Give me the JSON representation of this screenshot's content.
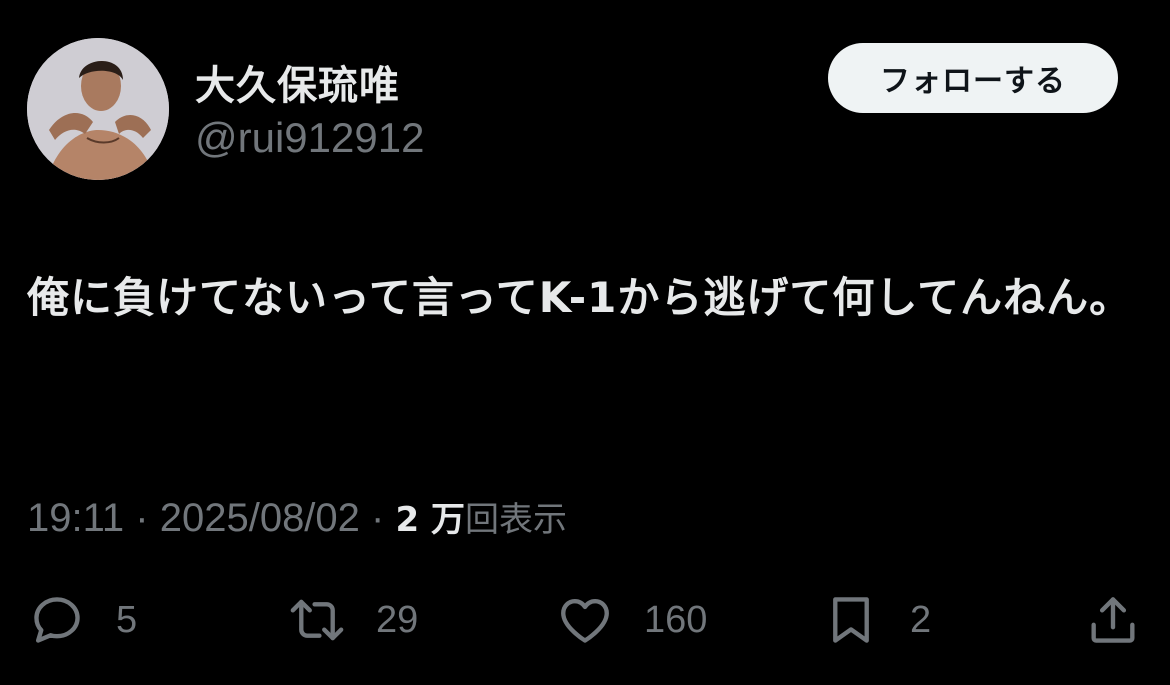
{
  "user": {
    "display_name": "大久保琉唯",
    "handle": "@rui912912",
    "avatar_icon": "avatar-photo"
  },
  "follow_button": {
    "label": "フォローする"
  },
  "tweet": {
    "text": "俺に負けてないって言ってK-1から逃げて何してんねん。"
  },
  "meta": {
    "time": "19:11",
    "separator": "·",
    "date": "2025/08/02",
    "views_count": "2 万",
    "views_label": "回表示"
  },
  "actions": {
    "reply": {
      "icon": "reply-icon",
      "count": "5"
    },
    "retweet": {
      "icon": "retweet-icon",
      "count": "29"
    },
    "like": {
      "icon": "heart-icon",
      "count": "160"
    },
    "bookmark": {
      "icon": "bookmark-icon",
      "count": "2"
    },
    "share": {
      "icon": "share-icon"
    }
  },
  "colors": {
    "background": "#000000",
    "text_primary": "#e7e9ea",
    "text_secondary": "#71767b",
    "button_bg": "#eff3f4"
  }
}
